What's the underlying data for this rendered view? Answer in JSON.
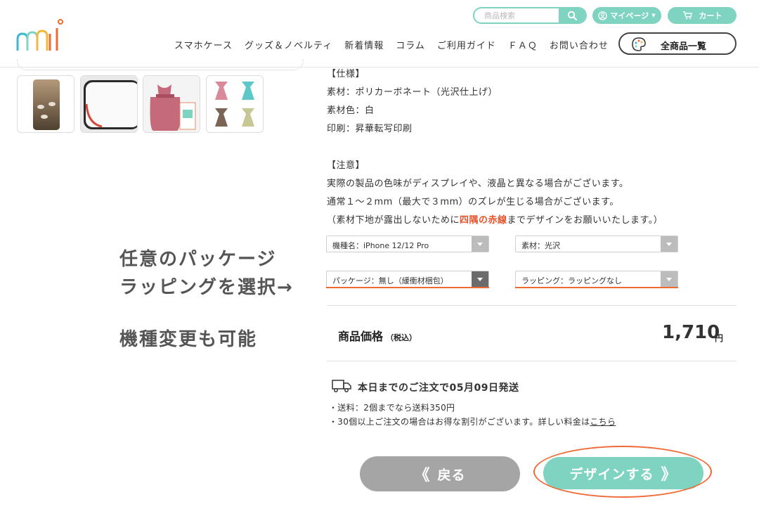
{
  "header": {
    "search_placeholder": "商品検索",
    "mypage_label": "マイページ",
    "cart_label": "カート",
    "nav": [
      "スマホケース",
      "グッズ＆ノベルティ",
      "新着情報",
      "コラム",
      "ご利用ガイド",
      "ＦＡＱ",
      "お問い合わせ"
    ],
    "all_items_label": "全商品一覧"
  },
  "overlay": {
    "line1": "任意のパッケージ",
    "line2": "ラッピングを選択→",
    "line3": "機種変更も可能"
  },
  "spec": {
    "heading": "【仕様】",
    "material": "素材：ポリカーボネート（光沢仕上げ）",
    "material_color": "素材色：白",
    "print": "印刷：昇華転写印刷",
    "caution_heading": "【注意】",
    "caution1": "実際の製品の色味がディスプレイや、液晶と異なる場合がございます。",
    "caution2": "通常１～２mm（最大で３mm）のズレが生じる場合がございます。",
    "caution3_pre": "（素材下地が露出しないために",
    "caution3_red": "四隅の赤線",
    "caution3_post": "までデザインをお願いいたします。）"
  },
  "options": {
    "model": "機種名：iPhone 12/12 Pro",
    "material": "素材：光沢",
    "package": "パッケージ：無し（緩衝材梱包）",
    "wrapping": "ラッピング：ラッピングなし"
  },
  "price": {
    "label": "商品価格",
    "tax_note": "（税込）",
    "value": "1,710",
    "unit": "円"
  },
  "shipping": {
    "headline": "本日までのご注文で05月09日発送",
    "line1": "・送料：2個までなら送料350円",
    "line2_pre": "・30個以上ご注文の場合はお得な割引がございます。詳しい料金は",
    "line2_link": "こちら"
  },
  "buttons": {
    "back": "戻る",
    "design": "デザインする"
  },
  "colors": {
    "accent": "#7fd3c1",
    "highlight": "#f06a35",
    "back_button": "#a5a5a5"
  }
}
